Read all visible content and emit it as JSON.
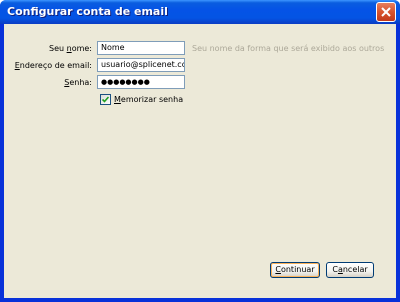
{
  "window": {
    "title": "Configurar conta de email"
  },
  "icons": {
    "close": "close-icon",
    "check": "checkmark-icon"
  },
  "form": {
    "name_label_pre": "Seu ",
    "name_label_key": "n",
    "name_label_post": "ome:",
    "name_value": "Nome",
    "name_hint": "Seu nome da forma que será exibido aos outros",
    "email_label_pre": "",
    "email_label_key": "E",
    "email_label_post": "ndereço de email:",
    "email_value": "usuario@splicenet.com.b",
    "password_label_pre": "",
    "password_label_key": "S",
    "password_label_post": "enha:",
    "password_value": "●●●●●●●●",
    "remember_key": "M",
    "remember_rest": "emorizar senha",
    "remember_checked": true
  },
  "buttons": {
    "continue_key": "C",
    "continue_rest": "ontinuar",
    "cancel_pre": "C",
    "cancel_key": "a",
    "cancel_rest": "ncelar"
  },
  "colors": {
    "titlebar": "#0553e6",
    "dialog_bg": "#ece9d8",
    "close_button": "#d8542e",
    "hint_text": "#aca899",
    "checkmark": "#21a121"
  }
}
